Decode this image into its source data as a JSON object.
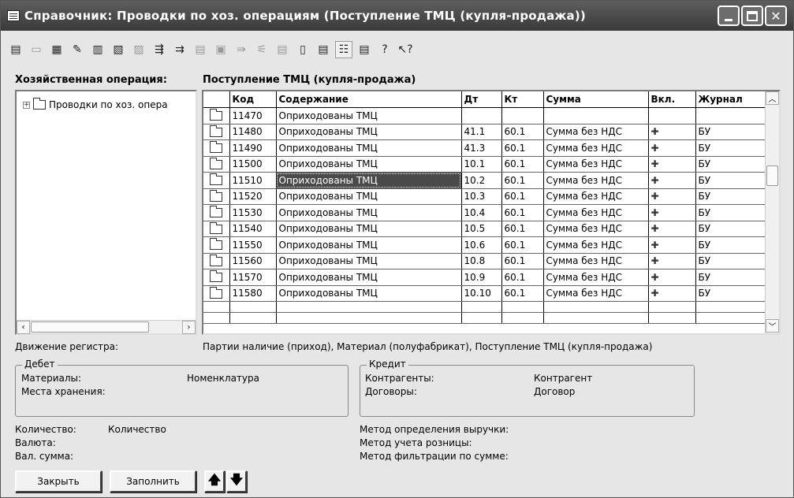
{
  "window": {
    "title": "Справочник: Проводки по хоз. операциям (Поступление ТМЦ (купля-продажа))"
  },
  "toolbar": {
    "icons": [
      "new-item-icon",
      "new-group-icon",
      "copy-icon",
      "edit-icon",
      "find-icon",
      "list-icon",
      "move-icon",
      "cut-icon",
      "filter-icon",
      "refresh-icon",
      "hierarchy-icon",
      "sort-icon",
      "select-icon",
      "paste-icon",
      "properties-icon",
      "tree-view-icon",
      "print-icon",
      "help-icon",
      "context-help-icon"
    ]
  },
  "header": {
    "operation_label": "Хозяйственная операция:",
    "operation_value": "Поступление ТМЦ (купля-продажа)"
  },
  "tree": {
    "root_label": "Проводки по хоз. опера"
  },
  "grid": {
    "columns": {
      "code": "Код",
      "content": "Содержание",
      "dt": "Дт",
      "kt": "Кт",
      "sum": "Сумма",
      "incl": "Вкл.",
      "journal": "Журнал"
    },
    "rows": [
      {
        "code": "11470",
        "content": "Оприходованы ТМЦ",
        "dt": "",
        "kt": "",
        "sum": "",
        "incl": "",
        "journal": ""
      },
      {
        "code": "11480",
        "content": "Оприходованы ТМЦ",
        "dt": "41.1",
        "kt": "60.1",
        "sum": "Сумма без НДС",
        "incl": "✚",
        "journal": "БУ"
      },
      {
        "code": "11490",
        "content": "Оприходованы ТМЦ",
        "dt": "41.3",
        "kt": "60.1",
        "sum": "Сумма без НДС",
        "incl": "✚",
        "journal": "БУ"
      },
      {
        "code": "11500",
        "content": "Оприходованы ТМЦ",
        "dt": "10.1",
        "kt": "60.1",
        "sum": "Сумма без НДС",
        "incl": "✚",
        "journal": "БУ"
      },
      {
        "code": "11510",
        "content": "Оприходованы ТМЦ",
        "dt": "10.2",
        "kt": "60.1",
        "sum": "Сумма без НДС",
        "incl": "✚",
        "journal": "БУ"
      },
      {
        "code": "11520",
        "content": "Оприходованы ТМЦ",
        "dt": "10.3",
        "kt": "60.1",
        "sum": "Сумма без НДС",
        "incl": "✚",
        "journal": "БУ"
      },
      {
        "code": "11530",
        "content": "Оприходованы ТМЦ",
        "dt": "10.4",
        "kt": "60.1",
        "sum": "Сумма без НДС",
        "incl": "✚",
        "journal": "БУ"
      },
      {
        "code": "11540",
        "content": "Оприходованы ТМЦ",
        "dt": "10.5",
        "kt": "60.1",
        "sum": "Сумма без НДС",
        "incl": "✚",
        "journal": "БУ"
      },
      {
        "code": "11550",
        "content": "Оприходованы ТМЦ",
        "dt": "10.6",
        "kt": "60.1",
        "sum": "Сумма без НДС",
        "incl": "✚",
        "journal": "БУ"
      },
      {
        "code": "11560",
        "content": "Оприходованы ТМЦ",
        "dt": "10.8",
        "kt": "60.1",
        "sum": "Сумма без НДС",
        "incl": "✚",
        "journal": "БУ"
      },
      {
        "code": "11570",
        "content": "Оприходованы ТМЦ",
        "dt": "10.9",
        "kt": "60.1",
        "sum": "Сумма без НДС",
        "incl": "✚",
        "journal": "БУ"
      },
      {
        "code": "11580",
        "content": "Оприходованы ТМЦ",
        "dt": "10.10",
        "kt": "60.1",
        "sum": "Сумма без НДС",
        "incl": "✚",
        "journal": "БУ"
      }
    ]
  },
  "details": {
    "register_label": "Движение регистра:",
    "register_value": "Партии наличие (приход), Материал (полуфабрикат), Поступление ТМЦ (купля-продажа)",
    "debit": {
      "title": "Дебет",
      "materials_label": "Материалы:",
      "materials_value": "Номенклатура",
      "storage_label": "Места хранения:"
    },
    "credit": {
      "title": "Кредит",
      "contractors_label": "Контрагенты:",
      "contractors_value": "Контрагент",
      "contracts_label": "Договоры:",
      "contracts_value": "Договор"
    },
    "quantity_label": "Количество:",
    "quantity_value": "Количество",
    "currency_label": "Валюта:",
    "cur_sum_label": "Вал. сумма:",
    "revenue_method_label": "Метод определения выручки:",
    "retail_method_label": "Метод учета розницы:",
    "filter_method_label": "Метод фильтрации по сумме:"
  },
  "buttons": {
    "close_label": "Закрыть",
    "fill_label": "Заполнить",
    "up_symbol": "🡅",
    "down_symbol": "🡇"
  }
}
